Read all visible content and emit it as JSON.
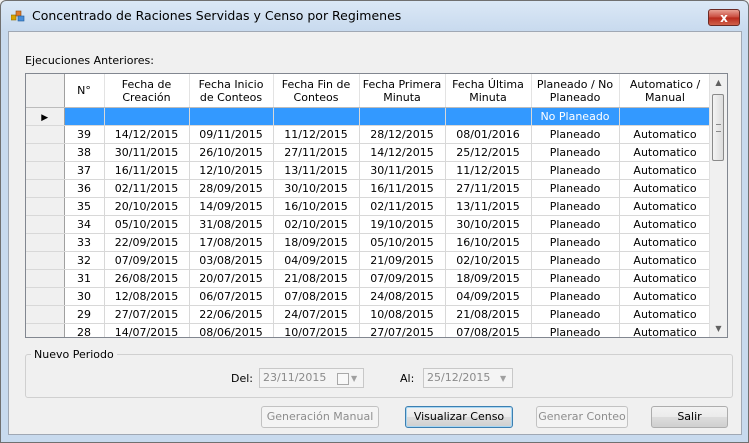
{
  "window": {
    "title": "Concentrado de Raciones Servidas y Censo por Regimenes",
    "close_glyph": "x"
  },
  "label_prev": "Ejecuciones Anteriores:",
  "grid": {
    "columns": [
      "N°",
      "Fecha de Creación",
      "Fecha Inicio de Conteos",
      "Fecha Fin de Conteos",
      "Fecha Primera Minuta",
      "Fecha Última Minuta",
      "Planeado / No Planeado",
      "Automatico / Manual"
    ],
    "current_row_marker": "▶",
    "rows": [
      [
        "",
        "",
        "",
        "",
        "",
        "",
        "No Planeado",
        ""
      ],
      [
        "39",
        "14/12/2015",
        "09/11/2015",
        "11/12/2015",
        "28/12/2015",
        "08/01/2016",
        "Planeado",
        "Automatico"
      ],
      [
        "38",
        "30/11/2015",
        "26/10/2015",
        "27/11/2015",
        "14/12/2015",
        "25/12/2015",
        "Planeado",
        "Automatico"
      ],
      [
        "37",
        "16/11/2015",
        "12/10/2015",
        "13/11/2015",
        "30/11/2015",
        "11/12/2015",
        "Planeado",
        "Automatico"
      ],
      [
        "36",
        "02/11/2015",
        "28/09/2015",
        "30/10/2015",
        "16/11/2015",
        "27/11/2015",
        "Planeado",
        "Automatico"
      ],
      [
        "35",
        "20/10/2015",
        "14/09/2015",
        "16/10/2015",
        "02/11/2015",
        "13/11/2015",
        "Planeado",
        "Automatico"
      ],
      [
        "34",
        "05/10/2015",
        "31/08/2015",
        "02/10/2015",
        "19/10/2015",
        "30/10/2015",
        "Planeado",
        "Automatico"
      ],
      [
        "33",
        "22/09/2015",
        "17/08/2015",
        "18/09/2015",
        "05/10/2015",
        "16/10/2015",
        "Planeado",
        "Automatico"
      ],
      [
        "32",
        "07/09/2015",
        "03/08/2015",
        "04/09/2015",
        "21/09/2015",
        "02/10/2015",
        "Planeado",
        "Automatico"
      ],
      [
        "31",
        "26/08/2015",
        "20/07/2015",
        "21/08/2015",
        "07/09/2015",
        "18/09/2015",
        "Planeado",
        "Automatico"
      ],
      [
        "30",
        "12/08/2015",
        "06/07/2015",
        "07/08/2015",
        "24/08/2015",
        "04/09/2015",
        "Planeado",
        "Automatico"
      ],
      [
        "29",
        "27/07/2015",
        "22/06/2015",
        "24/07/2015",
        "10/08/2015",
        "21/08/2015",
        "Planeado",
        "Automatico"
      ],
      [
        "28",
        "14/07/2015",
        "08/06/2015",
        "10/07/2015",
        "27/07/2015",
        "07/08/2015",
        "Planeado",
        "Automatico"
      ]
    ]
  },
  "nuevo_periodo": {
    "title": "Nuevo Periodo",
    "del_label": "Del:",
    "del_value": "23/11/2015",
    "al_label": "Al:",
    "al_value": "25/12/2015"
  },
  "buttons": {
    "generacion_manual": "Generación Manual",
    "visualizar_censo": "Visualizar Censo",
    "generar_conteo": "Generar Conteo",
    "salir": "Salir"
  }
}
